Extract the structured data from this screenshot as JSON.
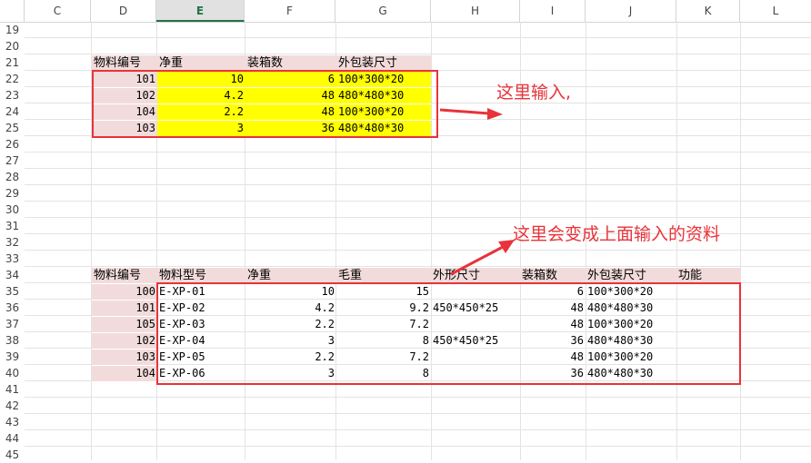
{
  "columns": [
    "C",
    "D",
    "E",
    "F",
    "G",
    "H",
    "I",
    "J",
    "K",
    "L"
  ],
  "rows": [
    "19",
    "20",
    "21",
    "22",
    "23",
    "24",
    "25",
    "26",
    "27",
    "28",
    "29",
    "30",
    "31",
    "32",
    "33",
    "34",
    "35",
    "36",
    "37",
    "38",
    "39",
    "40",
    "41",
    "42",
    "43",
    "44",
    "45"
  ],
  "top_table": {
    "headers": [
      "物料编号",
      "净重",
      "装箱数",
      "外包装尺寸"
    ],
    "rows": [
      [
        "101",
        "10",
        "6",
        "100*300*20"
      ],
      [
        "102",
        "4.2",
        "48",
        "480*480*30"
      ],
      [
        "104",
        "2.2",
        "48",
        "100*300*20"
      ],
      [
        "103",
        "3",
        "36",
        "480*480*30"
      ]
    ]
  },
  "bottom_table": {
    "headers": [
      "物料编号",
      "物料型号",
      "净重",
      "毛重",
      "外形尺寸",
      "装箱数",
      "外包装尺寸",
      "功能"
    ],
    "rows": [
      [
        "100",
        "E-XP-01",
        "10",
        "15",
        "",
        "6",
        "100*300*20",
        ""
      ],
      [
        "101",
        "E-XP-02",
        "4.2",
        "9.2",
        "450*450*25",
        "48",
        "480*480*30",
        ""
      ],
      [
        "105",
        "E-XP-03",
        "2.2",
        "7.2",
        "",
        "48",
        "100*300*20",
        ""
      ],
      [
        "102",
        "E-XP-04",
        "3",
        "8",
        "450*450*25",
        "36",
        "480*480*30",
        ""
      ],
      [
        "103",
        "E-XP-05",
        "2.2",
        "7.2",
        "",
        "48",
        "100*300*20",
        ""
      ],
      [
        "104",
        "E-XP-06",
        "3",
        "8",
        "",
        "36",
        "480*480*30",
        ""
      ]
    ]
  },
  "annotations": {
    "input_here": "这里输入,",
    "becomes_data": "这里会变成上面输入的资料"
  },
  "colors": {
    "annotation_red": "#e8333a",
    "input_yellow": "#ffff00",
    "header_pink": "#f2dcdb",
    "selected_green": "#217346"
  }
}
